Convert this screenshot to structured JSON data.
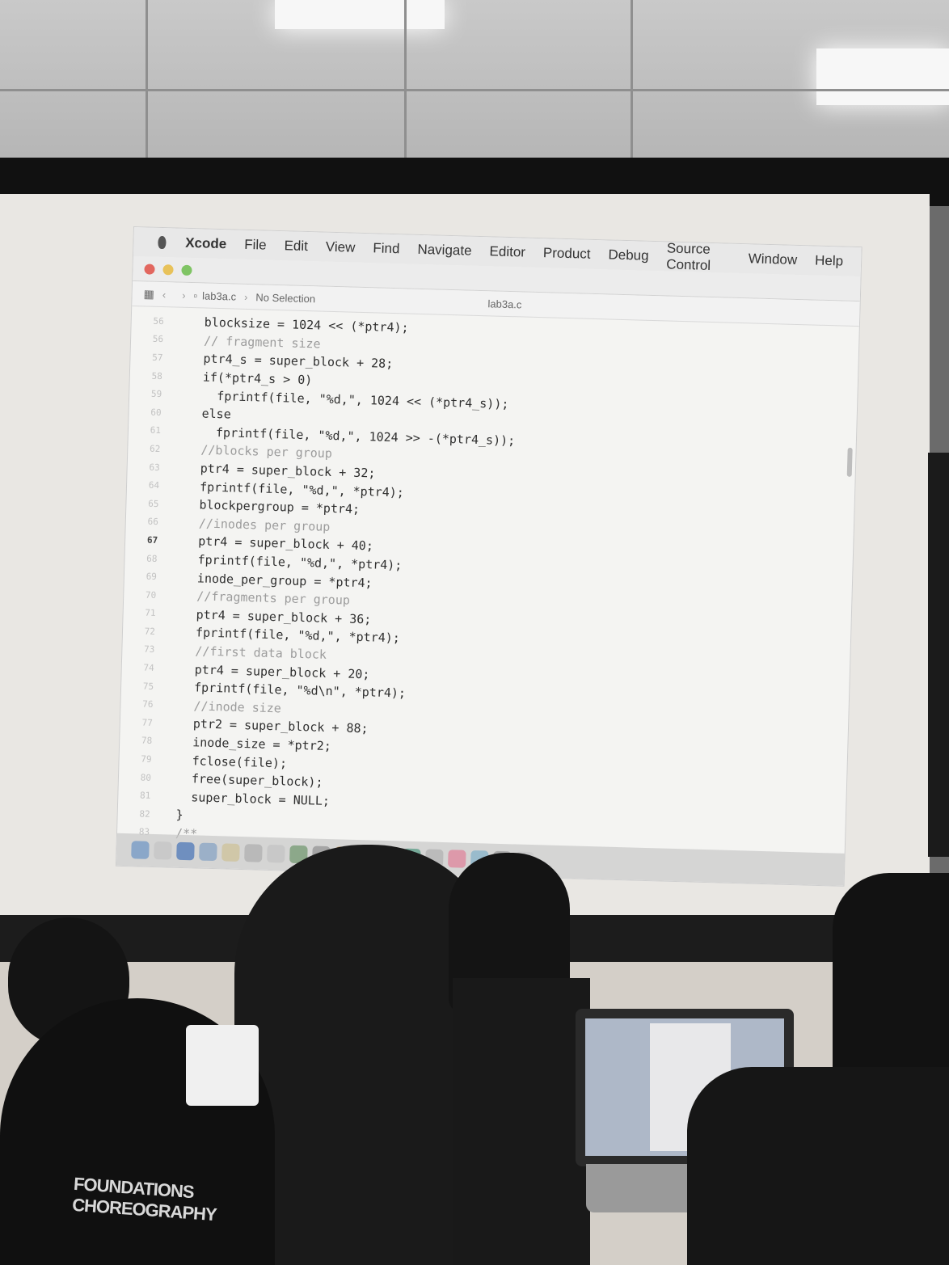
{
  "menubar": {
    "app_name": "Xcode",
    "items": [
      "File",
      "Edit",
      "View",
      "Find",
      "Navigate",
      "Editor",
      "Product",
      "Debug",
      "Source Control",
      "Window",
      "Help"
    ]
  },
  "pathbar": {
    "file": "lab3a.c",
    "selection": "No Selection",
    "window_title": "lab3a.c"
  },
  "editor": {
    "current_line": "67",
    "lines": [
      {
        "n": "56",
        "text": "  blocksize = 1024 << (*ptr4);",
        "comment": false
      },
      {
        "n": "56",
        "text": "  // fragment size",
        "comment": true
      },
      {
        "n": "57",
        "text": "  ptr4_s = super_block + 28;",
        "comment": false
      },
      {
        "n": "58",
        "text": "  if(*ptr4_s > 0)",
        "comment": false
      },
      {
        "n": "59",
        "text": "    fprintf(file, \"%d,\", 1024 << (*ptr4_s));",
        "comment": false
      },
      {
        "n": "60",
        "text": "  else",
        "comment": false
      },
      {
        "n": "61",
        "text": "    fprintf(file, \"%d,\", 1024 >> -(*ptr4_s));",
        "comment": false
      },
      {
        "n": "62",
        "text": "  //blocks per group",
        "comment": true
      },
      {
        "n": "63",
        "text": "  ptr4 = super_block + 32;",
        "comment": false
      },
      {
        "n": "64",
        "text": "  fprintf(file, \"%d,\", *ptr4);",
        "comment": false
      },
      {
        "n": "65",
        "text": "  blockpergroup = *ptr4;",
        "comment": false
      },
      {
        "n": "66",
        "text": "  //inodes per group",
        "comment": true
      },
      {
        "n": "67",
        "text": "  ptr4 = super_block + 40;",
        "comment": false
      },
      {
        "n": "68",
        "text": "  fprintf(file, \"%d,\", *ptr4);",
        "comment": false
      },
      {
        "n": "69",
        "text": "  inode_per_group = *ptr4;",
        "comment": false
      },
      {
        "n": "70",
        "text": "  //fragments per group",
        "comment": true
      },
      {
        "n": "71",
        "text": "  ptr4 = super_block + 36;",
        "comment": false
      },
      {
        "n": "72",
        "text": "  fprintf(file, \"%d,\", *ptr4);",
        "comment": false
      },
      {
        "n": "73",
        "text": "  //first data block",
        "comment": true
      },
      {
        "n": "74",
        "text": "  ptr4 = super_block + 20;",
        "comment": false
      },
      {
        "n": "75",
        "text": "  fprintf(file, \"%d\\n\", *ptr4);",
        "comment": false
      },
      {
        "n": "76",
        "text": "  //inode size",
        "comment": true
      },
      {
        "n": "77",
        "text": "  ptr2 = super_block + 88;",
        "comment": false
      },
      {
        "n": "78",
        "text": "  inode_size = *ptr2;",
        "comment": false
      },
      {
        "n": "79",
        "text": "  fclose(file);",
        "comment": false
      },
      {
        "n": "80",
        "text": "  free(super_block);",
        "comment": false
      },
      {
        "n": "81",
        "text": "  super_block = NULL;",
        "comment": false
      },
      {
        "n": "82",
        "text": "}",
        "comment": false
      },
      {
        "n": "83",
        "text": "/**",
        "comment": true
      }
    ]
  },
  "traffic_lights": {
    "close": "#e2675f",
    "minimize": "#e8c25a",
    "zoom": "#7fc464"
  },
  "audience": {
    "cap_text_line1": "FOUNDATIONS",
    "cap_text_line2": "CHOREOGRAPHY"
  }
}
